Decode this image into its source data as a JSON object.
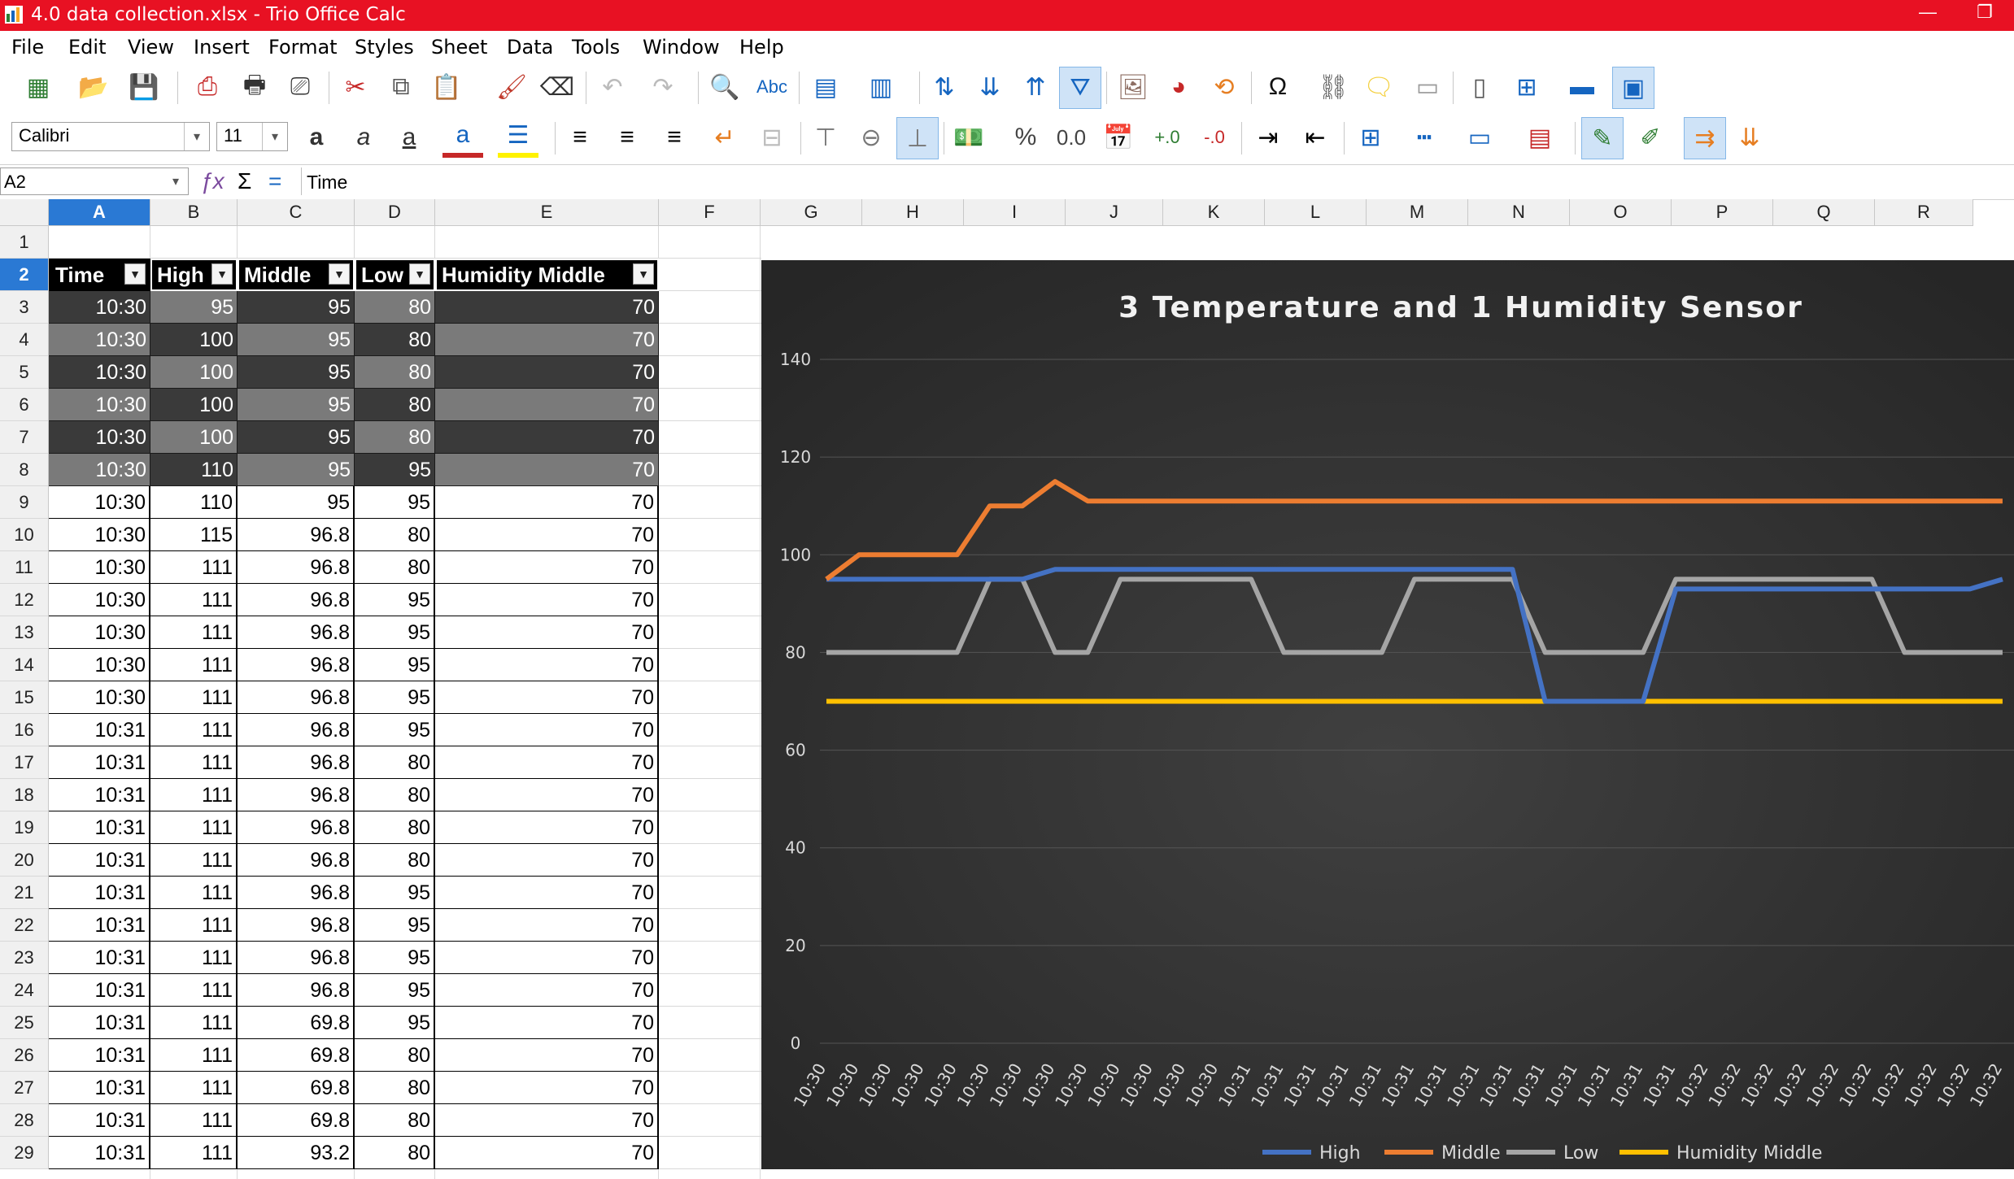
{
  "window": {
    "title": "4.0 data collection.xlsx - Trio Office Calc",
    "minimize": "—",
    "restore": "❐"
  },
  "menu": [
    {
      "label": "File"
    },
    {
      "label": "Edit"
    },
    {
      "label": "View"
    },
    {
      "label": "Insert"
    },
    {
      "label": "Format"
    },
    {
      "label": "Styles"
    },
    {
      "label": "Sheet"
    },
    {
      "label": "Data"
    },
    {
      "label": "Tools"
    },
    {
      "label": "Window"
    },
    {
      "label": "Help"
    }
  ],
  "toolbar": {
    "font_name": "Calibri",
    "font_size": "11"
  },
  "formula_bar": {
    "cell_ref": "A2",
    "content": "Time"
  },
  "columns": [
    "A",
    "B",
    "C",
    "D",
    "E",
    "F",
    "G",
    "H",
    "I",
    "J",
    "K",
    "L",
    "M",
    "N",
    "O",
    "P",
    "Q",
    "R"
  ],
  "rows": [
    "1",
    "2",
    "3",
    "4",
    "5",
    "6",
    "7",
    "8",
    "9",
    "10",
    "11",
    "12",
    "13",
    "14",
    "15",
    "16",
    "17",
    "18",
    "19",
    "20",
    "21",
    "22",
    "23",
    "24",
    "25",
    "26",
    "27",
    "28",
    "29"
  ],
  "table": {
    "headers": [
      "Time",
      "High",
      "Middle",
      "Low",
      "Humidity Middle"
    ],
    "rows": [
      [
        "10:30",
        "95",
        "95",
        "80",
        "70"
      ],
      [
        "10:30",
        "100",
        "95",
        "80",
        "70"
      ],
      [
        "10:30",
        "100",
        "95",
        "80",
        "70"
      ],
      [
        "10:30",
        "100",
        "95",
        "80",
        "70"
      ],
      [
        "10:30",
        "100",
        "95",
        "80",
        "70"
      ],
      [
        "10:30",
        "110",
        "95",
        "95",
        "70"
      ],
      [
        "10:30",
        "110",
        "95",
        "95",
        "70"
      ],
      [
        "10:30",
        "115",
        "96.8",
        "80",
        "70"
      ],
      [
        "10:30",
        "111",
        "96.8",
        "80",
        "70"
      ],
      [
        "10:30",
        "111",
        "96.8",
        "95",
        "70"
      ],
      [
        "10:30",
        "111",
        "96.8",
        "95",
        "70"
      ],
      [
        "10:30",
        "111",
        "96.8",
        "95",
        "70"
      ],
      [
        "10:30",
        "111",
        "96.8",
        "95",
        "70"
      ],
      [
        "10:31",
        "111",
        "96.8",
        "95",
        "70"
      ],
      [
        "10:31",
        "111",
        "96.8",
        "80",
        "70"
      ],
      [
        "10:31",
        "111",
        "96.8",
        "80",
        "70"
      ],
      [
        "10:31",
        "111",
        "96.8",
        "80",
        "70"
      ],
      [
        "10:31",
        "111",
        "96.8",
        "80",
        "70"
      ],
      [
        "10:31",
        "111",
        "96.8",
        "95",
        "70"
      ],
      [
        "10:31",
        "111",
        "96.8",
        "95",
        "70"
      ],
      [
        "10:31",
        "111",
        "96.8",
        "95",
        "70"
      ],
      [
        "10:31",
        "111",
        "96.8",
        "95",
        "70"
      ],
      [
        "10:31",
        "111",
        "69.8",
        "95",
        "70"
      ],
      [
        "10:31",
        "111",
        "69.8",
        "80",
        "70"
      ],
      [
        "10:31",
        "111",
        "69.8",
        "80",
        "70"
      ],
      [
        "10:31",
        "111",
        "69.8",
        "80",
        "70"
      ],
      [
        "10:31",
        "111",
        "93.2",
        "80",
        "70"
      ]
    ]
  },
  "chart_data": {
    "type": "line",
    "title": "3 Temperature and 1 Humidity Sensor",
    "ylim": [
      0,
      140
    ],
    "yticks": [
      "0",
      "20",
      "40",
      "60",
      "80",
      "100",
      "120",
      "140"
    ],
    "grid": true,
    "legend_position": "bottom",
    "background": "#2b2b2b",
    "categories": [
      "10:30",
      "10:30",
      "10:30",
      "10:30",
      "10:30",
      "10:30",
      "10:30",
      "10:30",
      "10:30",
      "10:30",
      "10:30",
      "10:30",
      "10:30",
      "10:31",
      "10:31",
      "10:31",
      "10:31",
      "10:31",
      "10:31",
      "10:31",
      "10:31",
      "10:31",
      "10:31",
      "10:31",
      "10:31",
      "10:31",
      "10:31",
      "10:32",
      "10:32",
      "10:32",
      "10:32",
      "10:32",
      "10:32",
      "10:32",
      "10:32",
      "10:32",
      "10:32"
    ],
    "series": [
      {
        "name": "High",
        "color": "#4472c4",
        "values": [
          95,
          95,
          95,
          95,
          95,
          95,
          95,
          97,
          97,
          97,
          97,
          97,
          97,
          97,
          97,
          97,
          97,
          97,
          97,
          97,
          97,
          97,
          70,
          70,
          70,
          70,
          93,
          93,
          93,
          93,
          93,
          93,
          93,
          93,
          93,
          93,
          95
        ]
      },
      {
        "name": "Middle",
        "color": "#ed7d31",
        "values": [
          95,
          100,
          100,
          100,
          100,
          110,
          110,
          115,
          111,
          111,
          111,
          111,
          111,
          111,
          111,
          111,
          111,
          111,
          111,
          111,
          111,
          111,
          111,
          111,
          111,
          111,
          111,
          111,
          111,
          111,
          111,
          111,
          111,
          111,
          111,
          111,
          111
        ]
      },
      {
        "name": "Low",
        "color": "#a5a5a5",
        "values": [
          80,
          80,
          80,
          80,
          80,
          95,
          95,
          80,
          80,
          95,
          95,
          95,
          95,
          95,
          80,
          80,
          80,
          80,
          95,
          95,
          95,
          95,
          80,
          80,
          80,
          80,
          95,
          95,
          95,
          95,
          95,
          95,
          95,
          80,
          80,
          80,
          80
        ]
      },
      {
        "name": "Humidity Middle",
        "color": "#ffc000",
        "values": [
          70,
          70,
          70,
          70,
          70,
          70,
          70,
          70,
          70,
          70,
          70,
          70,
          70,
          70,
          70,
          70,
          70,
          70,
          70,
          70,
          70,
          70,
          70,
          70,
          70,
          70,
          70,
          70,
          70,
          70,
          70,
          70,
          70,
          70,
          70,
          70,
          70
        ]
      }
    ]
  }
}
